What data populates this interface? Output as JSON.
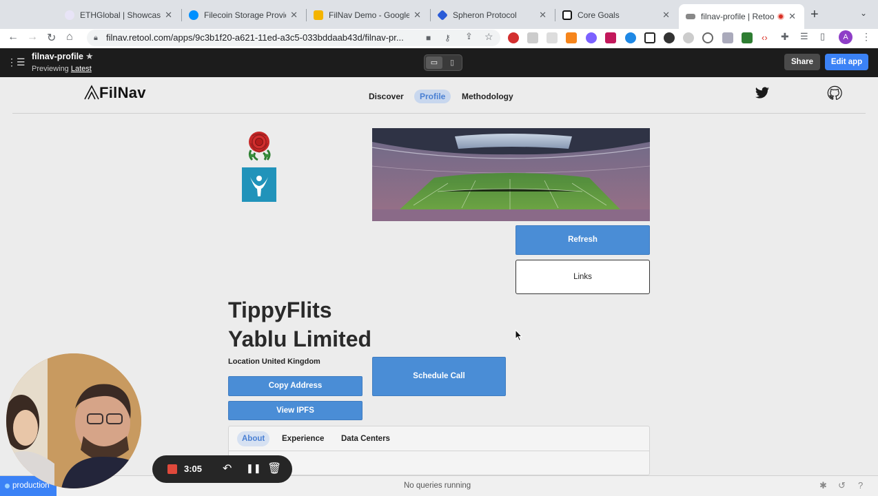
{
  "browser": {
    "tabs": [
      {
        "title": "ETHGlobal | Showcase",
        "favicon_color": "#e8e4f7"
      },
      {
        "title": "Filecoin Storage Provider",
        "favicon_color": "#0090ff"
      },
      {
        "title": "FilNav Demo - Google Sl",
        "favicon_color": "#f4b400"
      },
      {
        "title": "Spheron Protocol",
        "favicon_color": "#2a5bd7"
      },
      {
        "title": "Core Goals",
        "favicon_color": "#111111"
      },
      {
        "title": "filnav-profile | Retool",
        "favicon_color": "#888888"
      }
    ],
    "url": "filnav.retool.com/apps/9c3b1f20-a621-11ed-a3c5-033bddaab43d/filnav-pr...",
    "avatar_letter": "A"
  },
  "retool": {
    "app_name": "filnav-profile",
    "preview_prefix": "Previewing",
    "preview_version": "Latest",
    "share_label": "Share",
    "edit_label": "Edit app"
  },
  "app": {
    "logo": "FilNav",
    "nav": [
      "Discover",
      "Profile",
      "Methodology"
    ],
    "active_nav": "Profile",
    "refresh_label": "Refresh",
    "links_label": "Links",
    "name_line1": "TippyFlits",
    "name_line2": "Yablu Limited",
    "location": "Location United Kingdom",
    "copy_address_label": "Copy Address",
    "view_ipfs_label": "View IPFS",
    "schedule_call_label": "Schedule Call",
    "profile_tabs": [
      "About",
      "Experience",
      "Data Centers"
    ],
    "active_profile_tab": "About"
  },
  "status": {
    "environment": "production",
    "queries": "No queries running"
  },
  "recorder": {
    "time": "3:05"
  },
  "colors": {
    "accent": "#3b82f6",
    "button_blue": "#4a8dd6",
    "retool_header": "#1c1c1c"
  }
}
